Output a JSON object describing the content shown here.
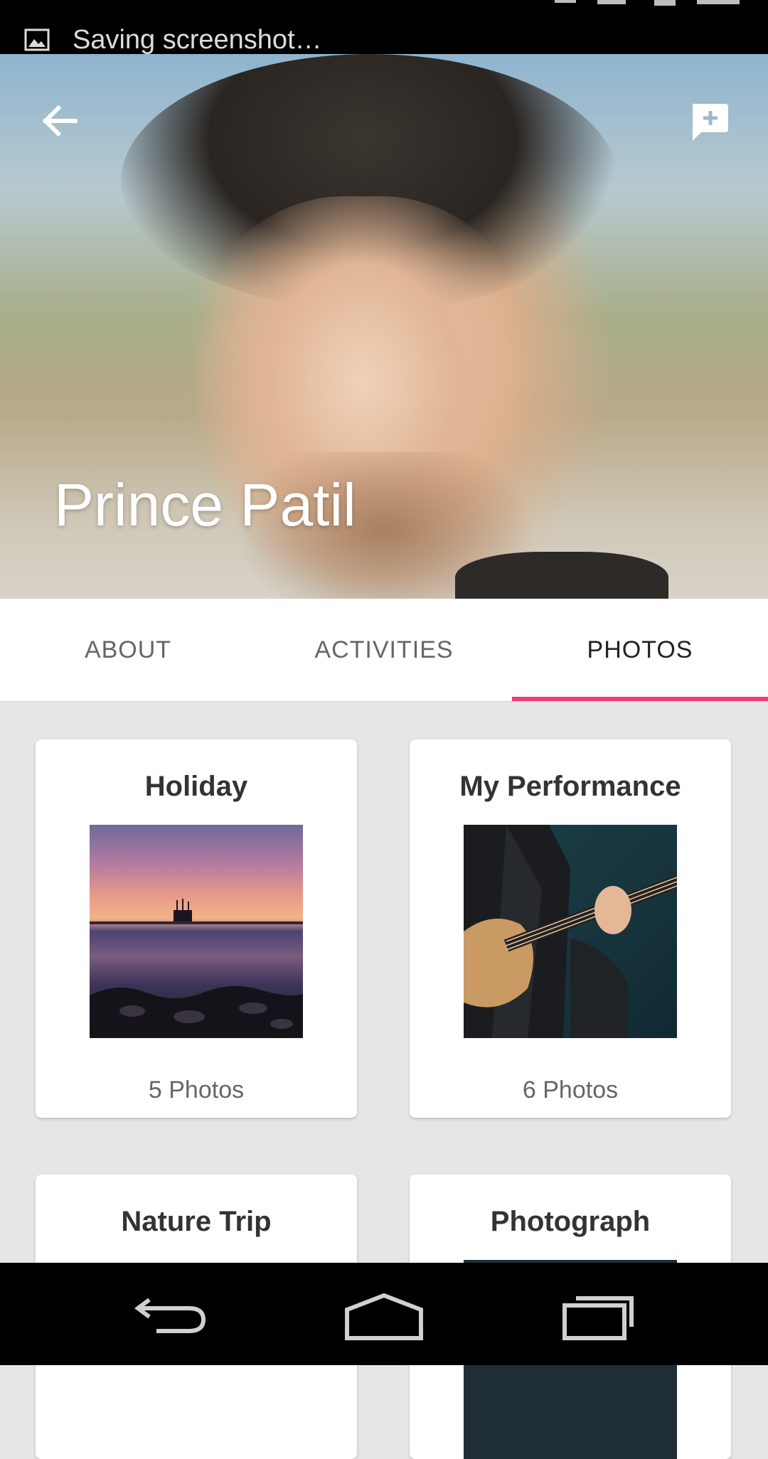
{
  "status_bar": {
    "notification_text": "Saving screenshot…"
  },
  "profile": {
    "name": "Prince Patil"
  },
  "icons": {
    "back": "arrow-left-icon",
    "chat": "chat-add-icon",
    "screenshot": "image-icon"
  },
  "tabs": [
    {
      "label": "ABOUT",
      "selected": false
    },
    {
      "label": "ACTIVITIES",
      "selected": false
    },
    {
      "label": "PHOTOS",
      "selected": true
    }
  ],
  "colors": {
    "accent": "#ee3b7b"
  },
  "albums": [
    {
      "title": "Holiday",
      "count": "5 Photos"
    },
    {
      "title": "My Performance",
      "count": "6 Photos"
    },
    {
      "title": "Nature Trip"
    },
    {
      "title": "Photograph"
    }
  ]
}
